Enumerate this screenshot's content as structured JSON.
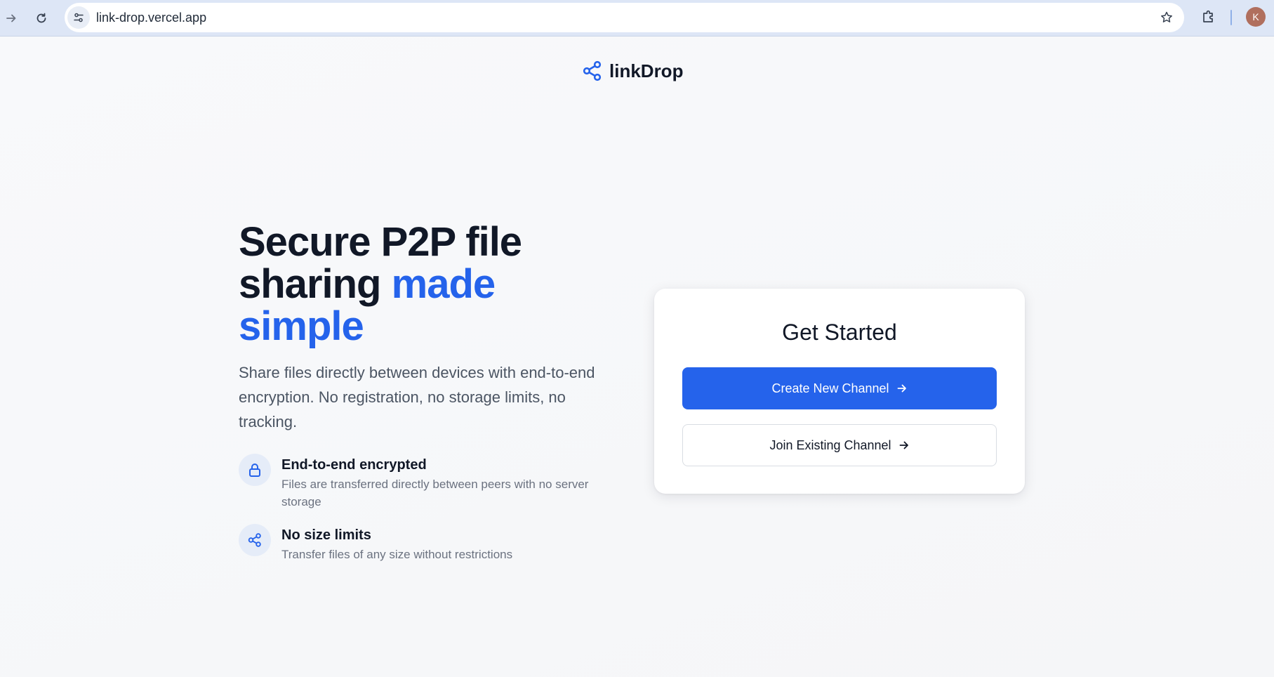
{
  "browser": {
    "url": "link-drop.vercel.app",
    "profile_initial": "K"
  },
  "brand": {
    "name": "linkDrop",
    "icon": "share-nodes-icon",
    "accent_color": "#2563eb"
  },
  "hero": {
    "headline_part1": "Secure P2P file sharing",
    "headline_accent": "made simple",
    "subtext": "Share files directly between devices with end-to-end encryption. No registration, no storage limits, no tracking."
  },
  "features": [
    {
      "icon": "lock-icon",
      "title": "End-to-end encrypted",
      "description": "Files are transferred directly between peers with no server storage"
    },
    {
      "icon": "share-nodes-icon",
      "title": "No size limits",
      "description": "Transfer files of any size without restrictions"
    }
  ],
  "card": {
    "title": "Get Started",
    "create_label": "Create New Channel",
    "join_label": "Join Existing Channel"
  }
}
